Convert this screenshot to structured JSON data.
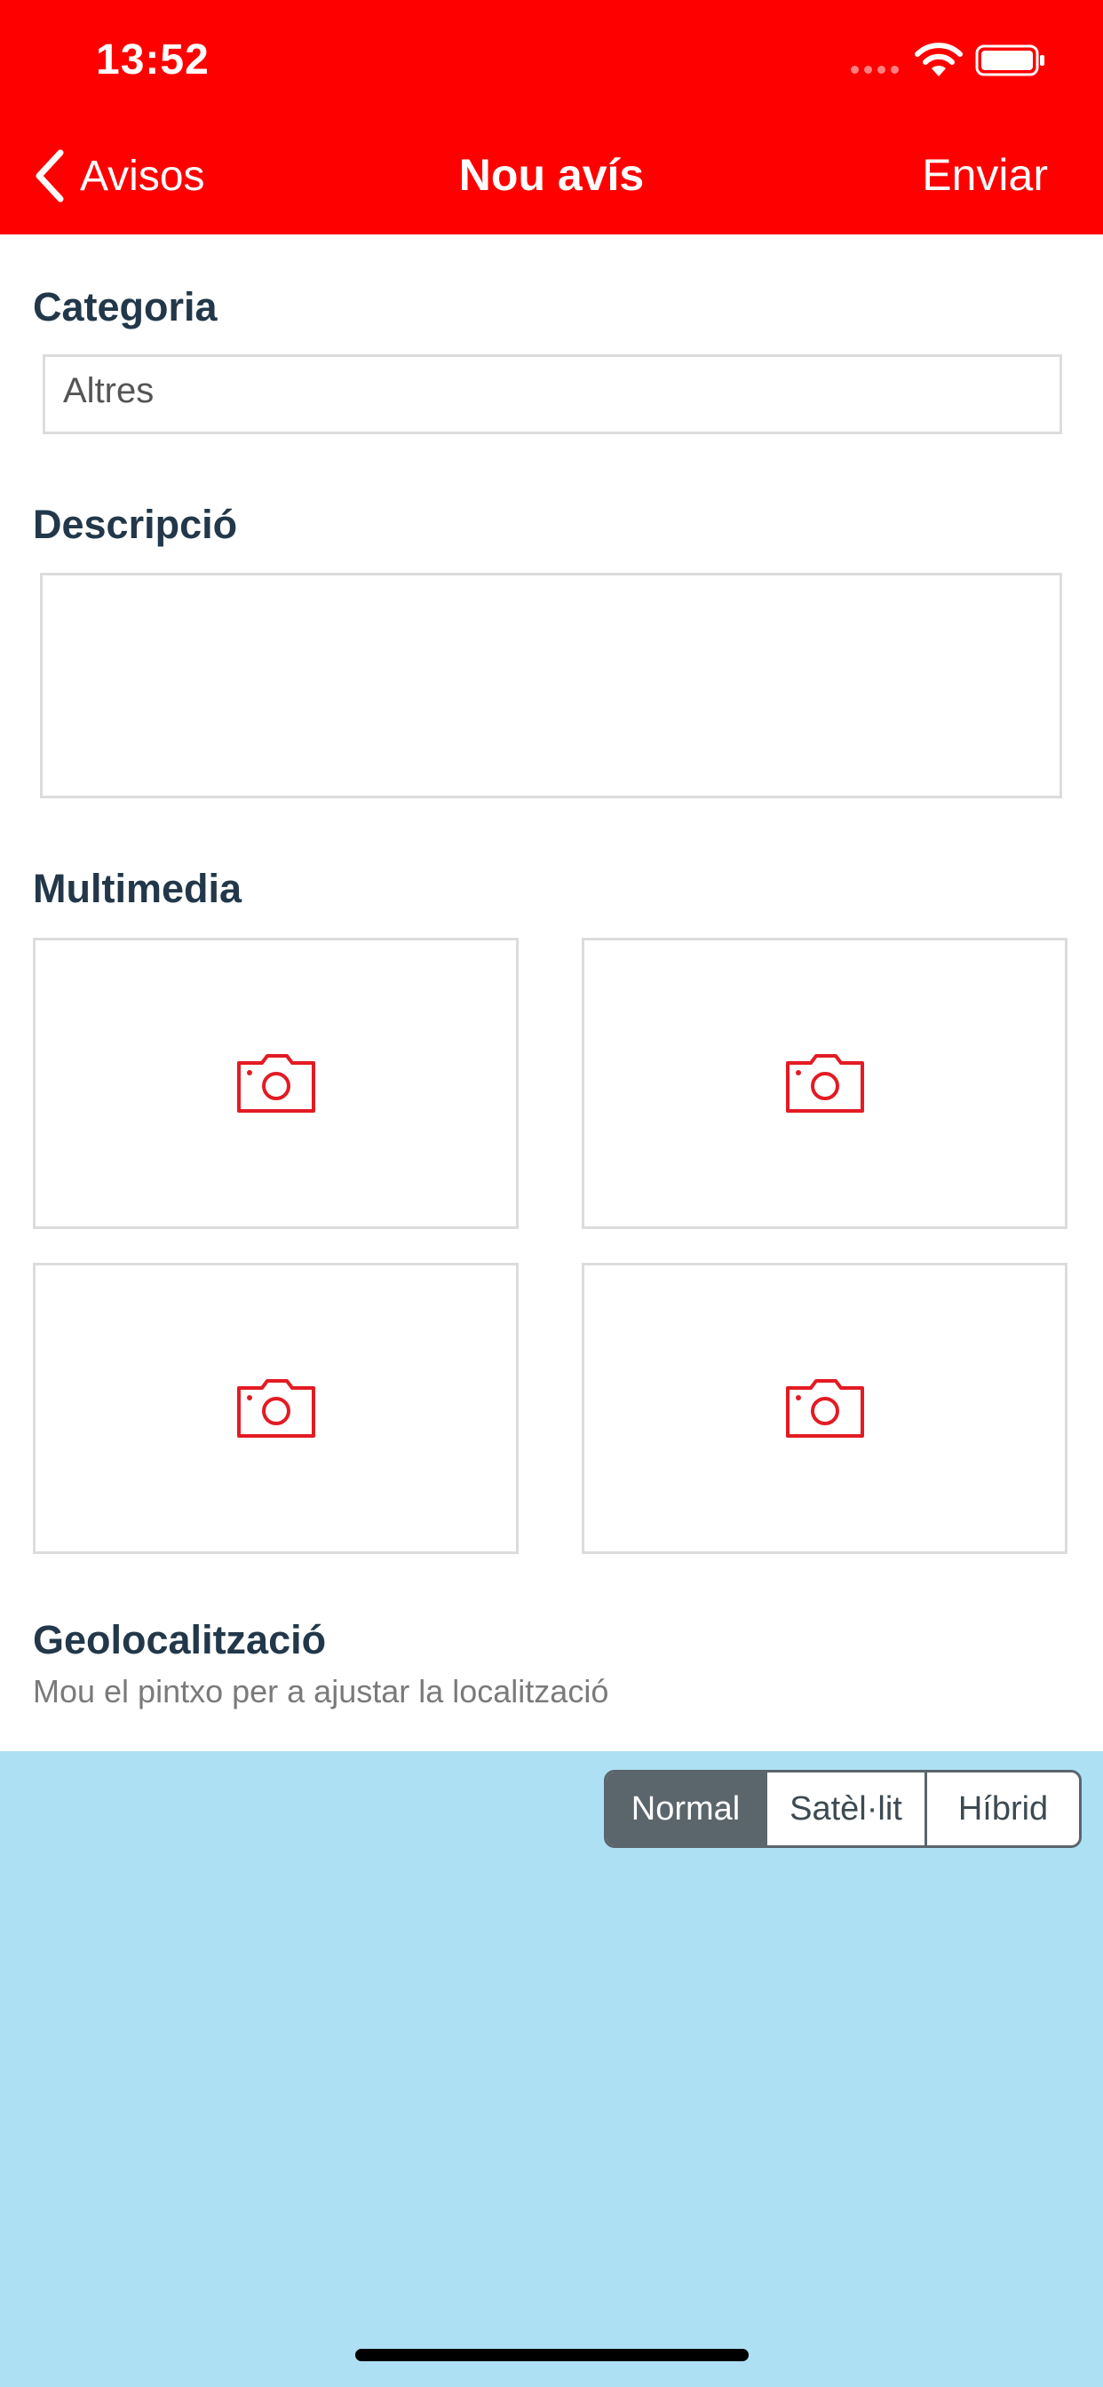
{
  "status_bar": {
    "time": "13:52"
  },
  "nav": {
    "back_label": "Avisos",
    "title": "Nou avís",
    "action_label": "Enviar"
  },
  "category": {
    "label": "Categoria",
    "value": "Altres"
  },
  "description": {
    "label": "Descripció",
    "value": ""
  },
  "multimedia": {
    "label": "Multimedia",
    "slots": [
      "camera-icon",
      "camera-icon",
      "camera-icon",
      "camera-icon"
    ]
  },
  "geolocation": {
    "label": "Geolocalització",
    "hint": "Mou el pintxo per a ajustar la localització"
  },
  "map_type": {
    "options": [
      "Normal",
      "Satèl·lit",
      "Híbrid"
    ],
    "selected": "Normal"
  },
  "colors": {
    "header": "#ff0000",
    "accent_icon": "#e31b23",
    "section_label": "#22384a",
    "map_water": "#aee0f4",
    "segment_active": "#5a656c"
  }
}
